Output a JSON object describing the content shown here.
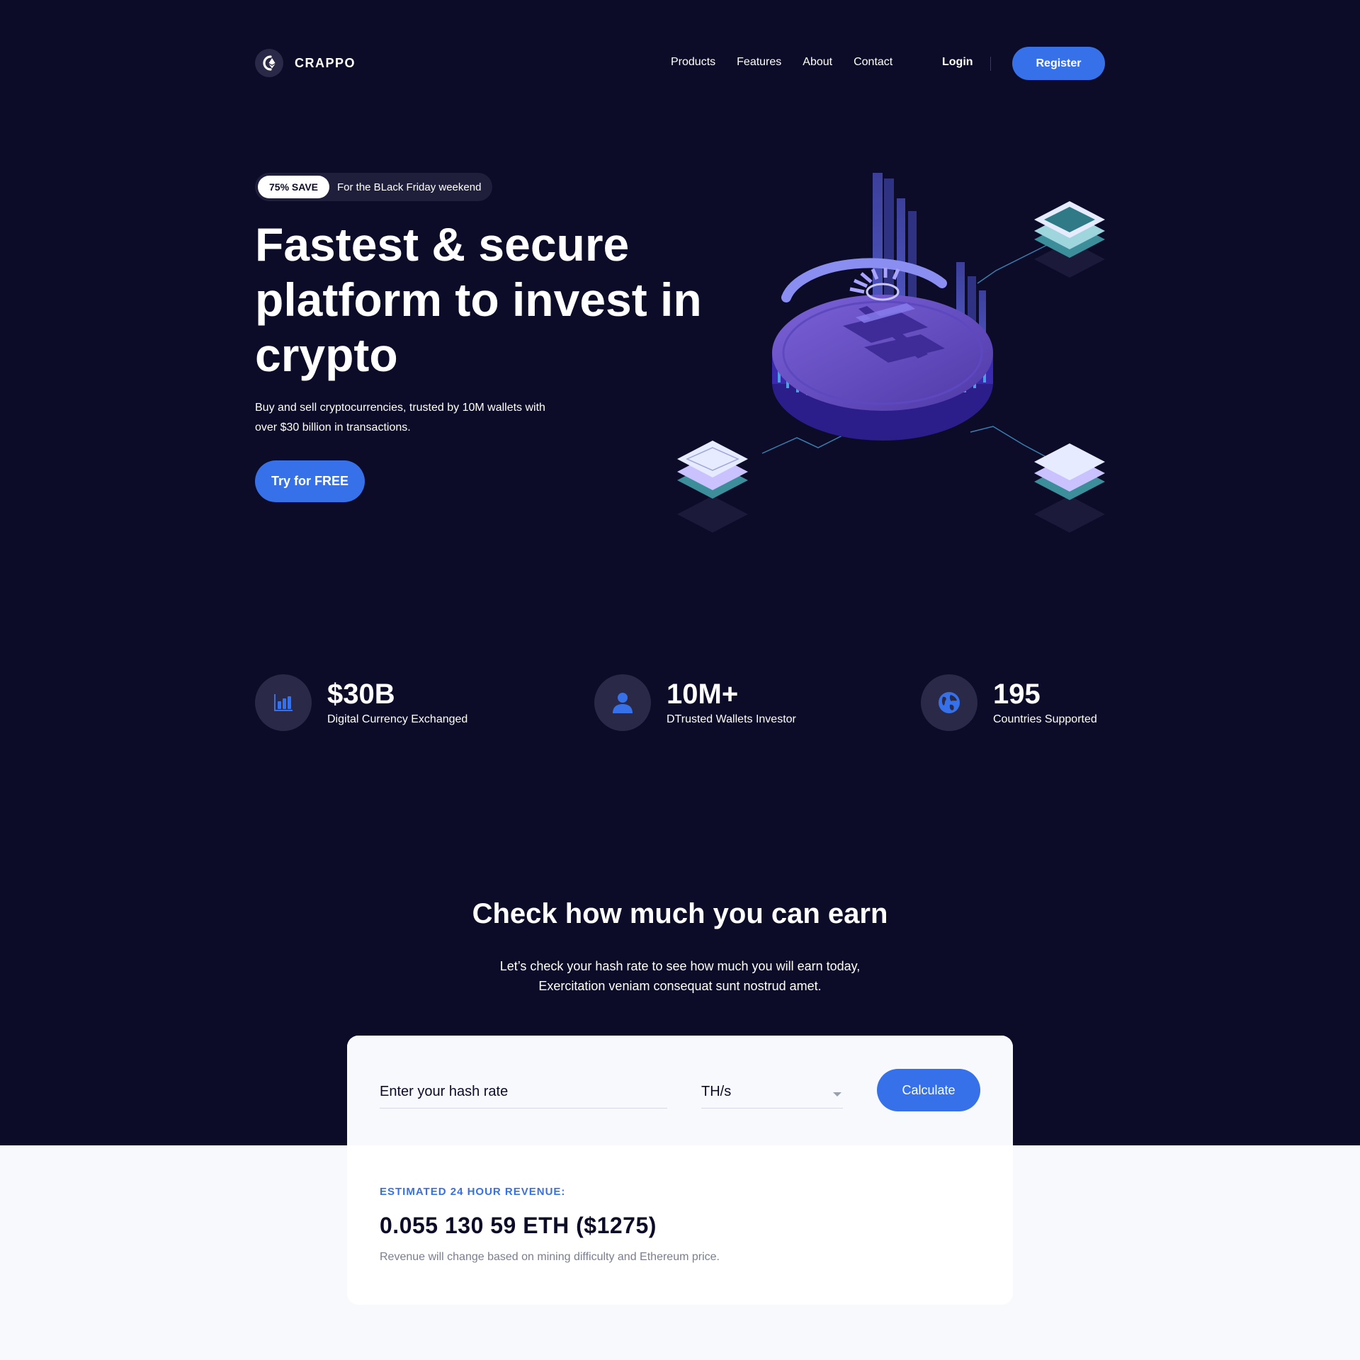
{
  "brand": {
    "name": "CRAPPO",
    "logo_icon": "ethereum-logo-icon"
  },
  "nav": {
    "links": [
      "Products",
      "Features",
      "About",
      "Contact"
    ],
    "login_label": "Login",
    "register_label": "Register"
  },
  "hero": {
    "promo_badge": "75% SAVE",
    "promo_text": "For the BLack Friday weekend",
    "title": "Fastest & secure platform to invest in crypto",
    "subtitle": "Buy and sell cryptocurrencies, trusted by 10M wallets with over $30 billion in transactions.",
    "cta_label": "Try for FREE",
    "illustration_icon": "bitcoin-coin-illustration"
  },
  "stats": [
    {
      "icon": "bar-chart-icon",
      "value": "$30B",
      "label": "Digital Currency Exchanged"
    },
    {
      "icon": "user-icon",
      "value": "10M+",
      "label": "DTrusted Wallets Investor"
    },
    {
      "icon": "globe-icon",
      "value": "195",
      "label": "Countries Supported"
    }
  ],
  "earn": {
    "title": "Check how much you can earn",
    "subtitle": "Let’s check your hash rate to see how much you will earn today, Exercitation veniam consequat sunt nostrud amet.",
    "input_placeholder": "Enter your hash rate",
    "unit_selected": "TH/s",
    "calculate_label": "Calculate",
    "revenue_label": "ESTIMATED 24 HOUR REVENUE:",
    "revenue_value": "0.055 130 59 ETH ($1275)",
    "revenue_note": "Revenue will change based on mining difficulty and Ethereum price."
  },
  "colors": {
    "dark_bg": "#0c0c28",
    "accent": "#3671e9",
    "light_bg": "#f8f9fc"
  }
}
